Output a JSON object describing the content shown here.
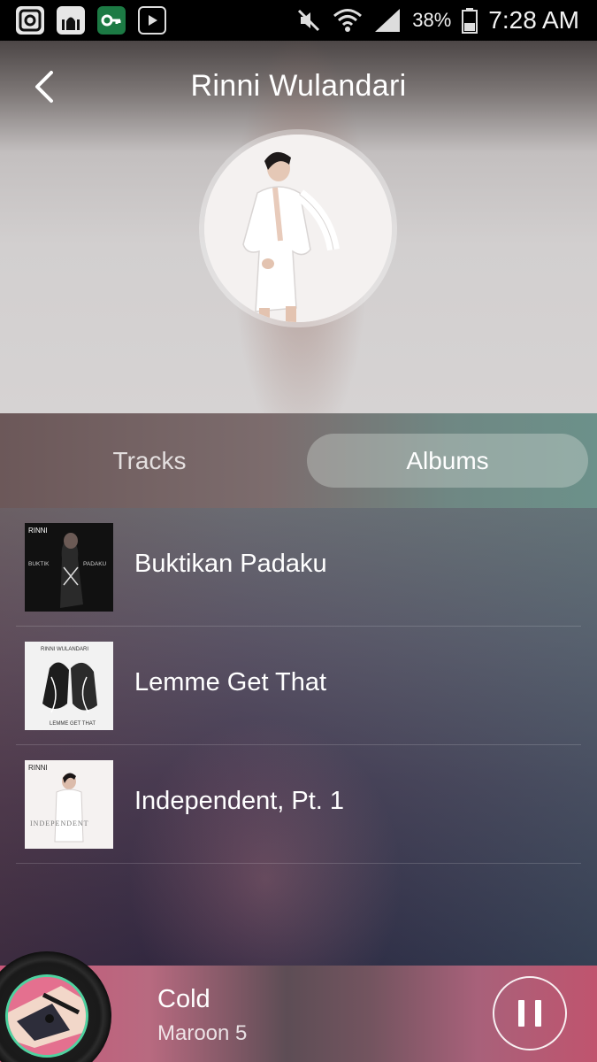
{
  "status_bar": {
    "battery": "38%",
    "time": "7:28 AM",
    "icons": [
      "camera-app-icon",
      "mosque-app-icon",
      "key-app-icon",
      "play-store-icon",
      "mute-icon",
      "wifi-icon",
      "signal-icon",
      "battery-icon"
    ]
  },
  "header": {
    "title": "Rinni Wulandari",
    "back_icon": "chevron-left-icon"
  },
  "tabs": [
    {
      "label": "Tracks",
      "active": false
    },
    {
      "label": "Albums",
      "active": true
    }
  ],
  "albums": [
    {
      "title": "Buktikan Padaku",
      "art_text": "RINNI WULANDARI",
      "art_sub": "BUKTIKAN PADAKU"
    },
    {
      "title": "Lemme Get That",
      "art_text": "RINNI WULANDARI",
      "art_sub": "LEMME GET THAT"
    },
    {
      "title": "Independent, Pt. 1",
      "art_text": "RINNI WULANDARI",
      "art_sub": "INDEPENDENT"
    }
  ],
  "now_playing": {
    "title": "Cold",
    "artist": "Maroon 5",
    "state": "playing",
    "control_icon": "pause-icon"
  },
  "colors": {
    "accent_ring": "#4fd2a0",
    "player_bg": "#c8577a"
  }
}
